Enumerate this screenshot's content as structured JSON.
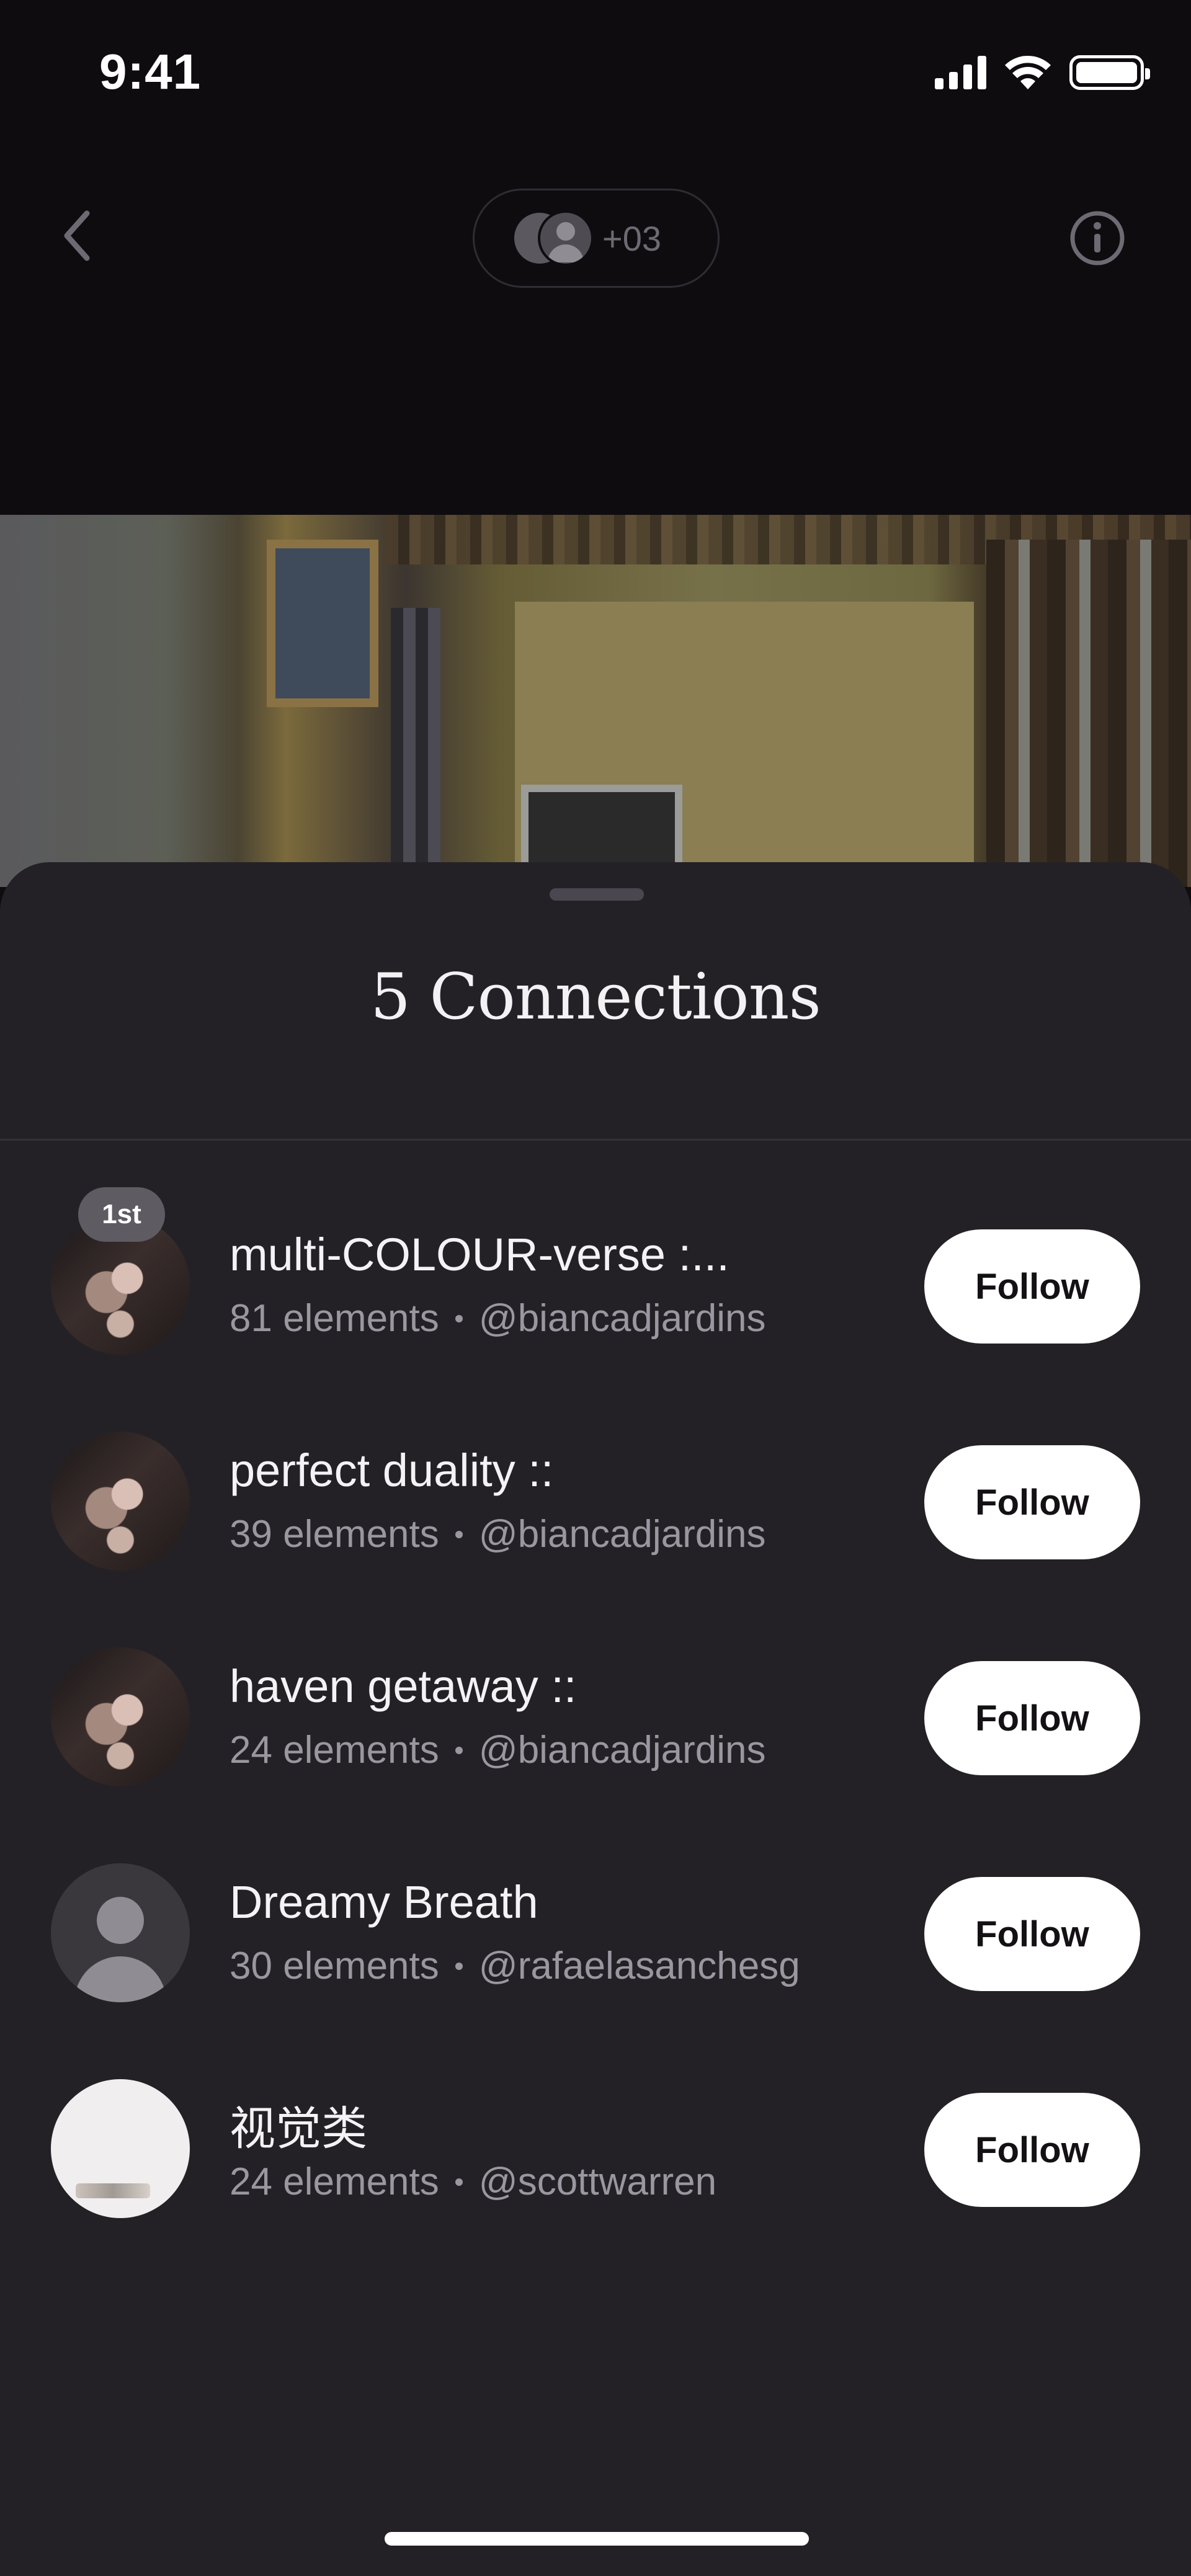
{
  "status_bar": {
    "time": "9:41"
  },
  "header": {
    "collaborator_count": "+03"
  },
  "sheet": {
    "title": "5 Connections",
    "rows": [
      {
        "title": "multi-COLOUR-verse :...",
        "elements": "81 elements",
        "handle": "@biancadjardins",
        "badge": "1st",
        "follow_label": "Follow",
        "avatar": "photo"
      },
      {
        "title": "perfect duality ::",
        "elements": "39 elements",
        "handle": "@biancadjardins",
        "follow_label": "Follow",
        "avatar": "photo"
      },
      {
        "title": "haven getaway ::",
        "elements": "24 elements",
        "handle": "@biancadjardins",
        "follow_label": "Follow",
        "avatar": "photo"
      },
      {
        "title": "Dreamy Breath",
        "elements": "30 elements",
        "handle": "@rafaelasanchesg",
        "follow_label": "Follow",
        "avatar": "default"
      },
      {
        "title": "视觉类",
        "elements": "24 elements",
        "handle": "@scottwarren",
        "follow_label": "Follow",
        "avatar": "white"
      }
    ]
  },
  "icons": [
    "signal-icon",
    "wifi-icon",
    "battery-icon",
    "back-chevron-icon",
    "info-icon",
    "person-icon"
  ],
  "colors": {
    "background": "#0f0c10",
    "sheet": "#242126",
    "button": "#ffffff",
    "secondary_text": "#9b97a0"
  }
}
